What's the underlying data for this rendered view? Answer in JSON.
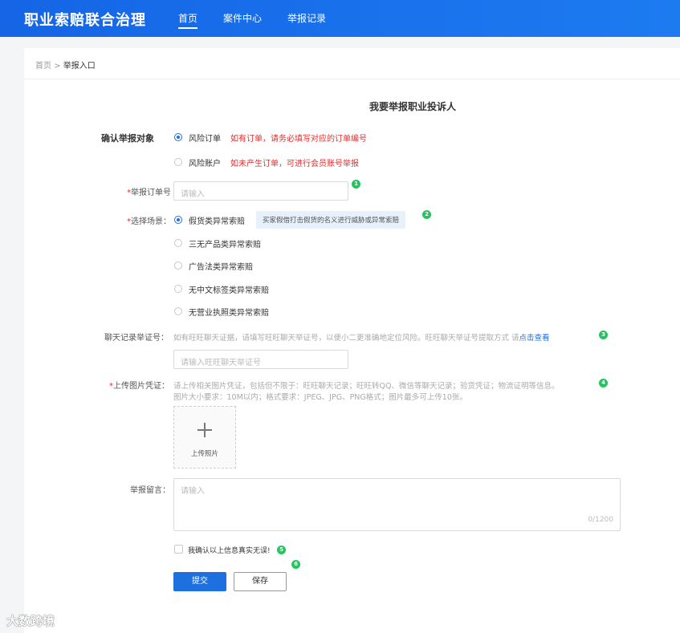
{
  "header": {
    "brand": "职业索赔联合治理",
    "nav": [
      "首页",
      "案件中心",
      "举报记录"
    ]
  },
  "breadcrumb": {
    "home": "首页",
    "sep": ">",
    "current": "举报入口"
  },
  "form": {
    "title": "我要举报职业投诉人",
    "target": {
      "label": "确认举报对象",
      "options": [
        {
          "label": "风险订单",
          "note": "如有订单，请务必填写对应的订单编号",
          "selected": true
        },
        {
          "label": "风险账户",
          "note": "如未产生订单，可进行会员账号举报",
          "selected": false
        }
      ]
    },
    "order": {
      "label": "举报订单号",
      "placeholder": "请输入",
      "badge": "1"
    },
    "scene": {
      "label": "选择场景：",
      "badge": "2",
      "tip": "买家假借打击假货的名义进行威胁或异常索赔",
      "options": [
        {
          "label": "假货类异常索赔",
          "selected": true
        },
        {
          "label": "三无产品类异常索赔",
          "selected": false
        },
        {
          "label": "广告法类异常索赔",
          "selected": false
        },
        {
          "label": "无中文标签类异常索赔",
          "selected": false
        },
        {
          "label": "无营业执照类异常索赔",
          "selected": false
        }
      ]
    },
    "chat": {
      "label": "聊天记录举证号：",
      "hint": "如有旺旺聊天证据，请填写旺旺聊天举证号，以便小二更准确地定位风险。旺旺聊天举证号提取方式 请",
      "link": "点击查看",
      "placeholder": "请输入旺旺聊天举证号",
      "badge": "3"
    },
    "images": {
      "label": "上传图片凭证：",
      "hint1": "请上传相关图片凭证，包括但不限于：旺旺聊天记录；旺旺转QQ、微信等聊天记录；验货凭证；物流证明等信息。",
      "hint2": "图片大小要求：10M以内；格式要求：JPEG、JPG、PNG格式；图片最多可上传10张。",
      "upload_text": "上传照片",
      "badge": "4"
    },
    "message": {
      "label": "举报留言：",
      "placeholder": "请输入",
      "counter": "0/1200"
    },
    "confirm": {
      "label": "我确认以上信息真实无误!",
      "badge": "5",
      "checked": false
    },
    "buttons": {
      "submit": "提交",
      "save": "保存",
      "badge": "6"
    }
  },
  "watermark": "大数跨境"
}
